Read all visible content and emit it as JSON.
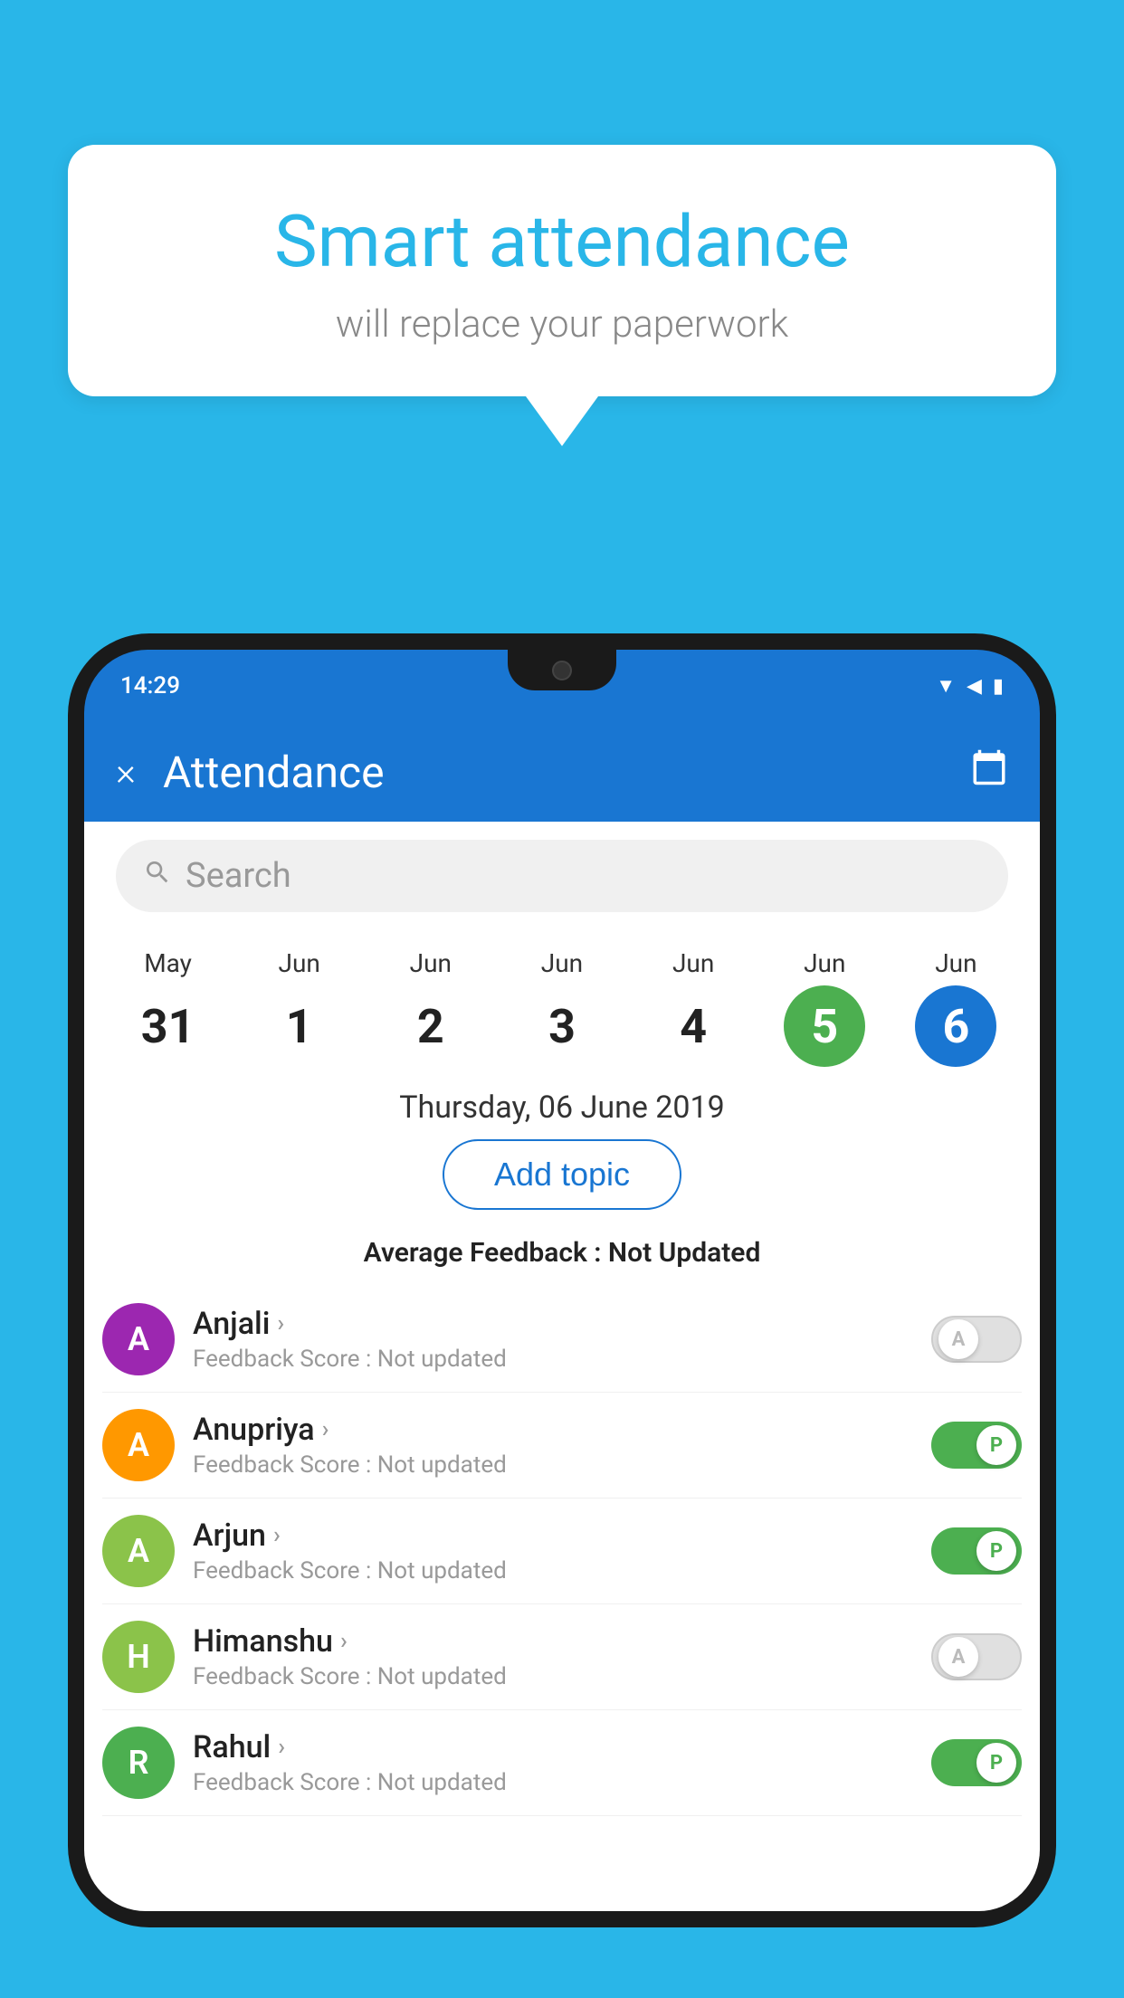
{
  "background_color": "#29b6e8",
  "bubble": {
    "title": "Smart attendance",
    "subtitle": "will replace your paperwork"
  },
  "status_bar": {
    "time": "14:29",
    "icons": [
      "wifi",
      "signal",
      "battery"
    ]
  },
  "app_bar": {
    "title": "Attendance",
    "close_label": "×",
    "calendar_icon": "📅"
  },
  "search": {
    "placeholder": "Search"
  },
  "calendar": {
    "days": [
      {
        "month": "May",
        "num": "31",
        "state": "normal"
      },
      {
        "month": "Jun",
        "num": "1",
        "state": "normal"
      },
      {
        "month": "Jun",
        "num": "2",
        "state": "normal"
      },
      {
        "month": "Jun",
        "num": "3",
        "state": "normal"
      },
      {
        "month": "Jun",
        "num": "4",
        "state": "normal"
      },
      {
        "month": "Jun",
        "num": "5",
        "state": "today"
      },
      {
        "month": "Jun",
        "num": "6",
        "state": "selected"
      }
    ]
  },
  "selected_date": "Thursday, 06 June 2019",
  "add_topic_label": "Add topic",
  "avg_feedback_label": "Average Feedback :",
  "avg_feedback_value": "Not Updated",
  "students": [
    {
      "name": "Anjali",
      "avatar_letter": "A",
      "avatar_color": "#9c27b0",
      "feedback_label": "Feedback Score :",
      "feedback_value": "Not updated",
      "toggle": "off",
      "toggle_letter": "A"
    },
    {
      "name": "Anupriya",
      "avatar_letter": "A",
      "avatar_color": "#ff9800",
      "feedback_label": "Feedback Score :",
      "feedback_value": "Not updated",
      "toggle": "on",
      "toggle_letter": "P"
    },
    {
      "name": "Arjun",
      "avatar_letter": "A",
      "avatar_color": "#8bc34a",
      "feedback_label": "Feedback Score :",
      "feedback_value": "Not updated",
      "toggle": "on",
      "toggle_letter": "P"
    },
    {
      "name": "Himanshu",
      "avatar_letter": "H",
      "avatar_color": "#8bc34a",
      "feedback_label": "Feedback Score :",
      "feedback_value": "Not updated",
      "toggle": "off",
      "toggle_letter": "A"
    },
    {
      "name": "Rahul",
      "avatar_letter": "R",
      "avatar_color": "#4caf50",
      "feedback_label": "Feedback Score :",
      "feedback_value": "Not updated",
      "toggle": "on",
      "toggle_letter": "P"
    }
  ]
}
